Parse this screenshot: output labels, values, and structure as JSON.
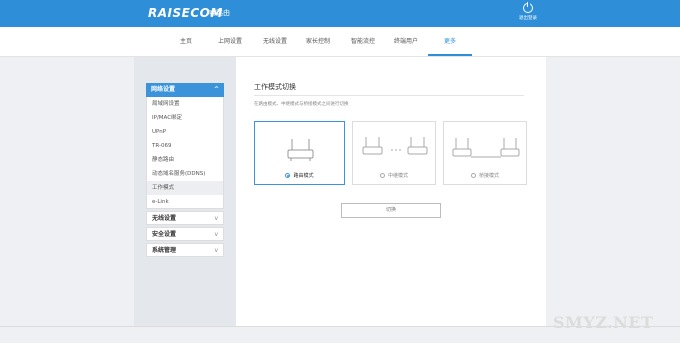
{
  "header": {
    "brand": "RAISECOM",
    "brand_sub": "睿路由",
    "logout_label": "退出登录"
  },
  "nav": {
    "items": [
      "主页",
      "上网设置",
      "无线设置",
      "家长控制",
      "智能流控",
      "终端用户",
      "更多"
    ],
    "active": "更多"
  },
  "sidebar": {
    "network": {
      "label": "网络设置",
      "items": [
        "局域网设置",
        "IP/MAC绑定",
        "UPnP",
        "TR-069",
        "静态路由",
        "动态域名服务(DDNS)",
        "工作模式",
        "e-Link"
      ],
      "active_item": "工作模式"
    },
    "groups": [
      "无线设置",
      "安全设置",
      "系统管理"
    ]
  },
  "panel": {
    "title": "工作模式切换",
    "description": "在路由模式、中继模式与桥接模式之间进行切换",
    "modes": [
      {
        "label": "路由模式",
        "selected": true
      },
      {
        "label": "中继模式",
        "selected": false
      },
      {
        "label": "桥接模式",
        "selected": false
      }
    ],
    "switch_button": "切换"
  },
  "watermark": "SMYZ.NET",
  "colors": {
    "accent": "#2e8fd8",
    "sidebar_head": "#3b93d9"
  }
}
